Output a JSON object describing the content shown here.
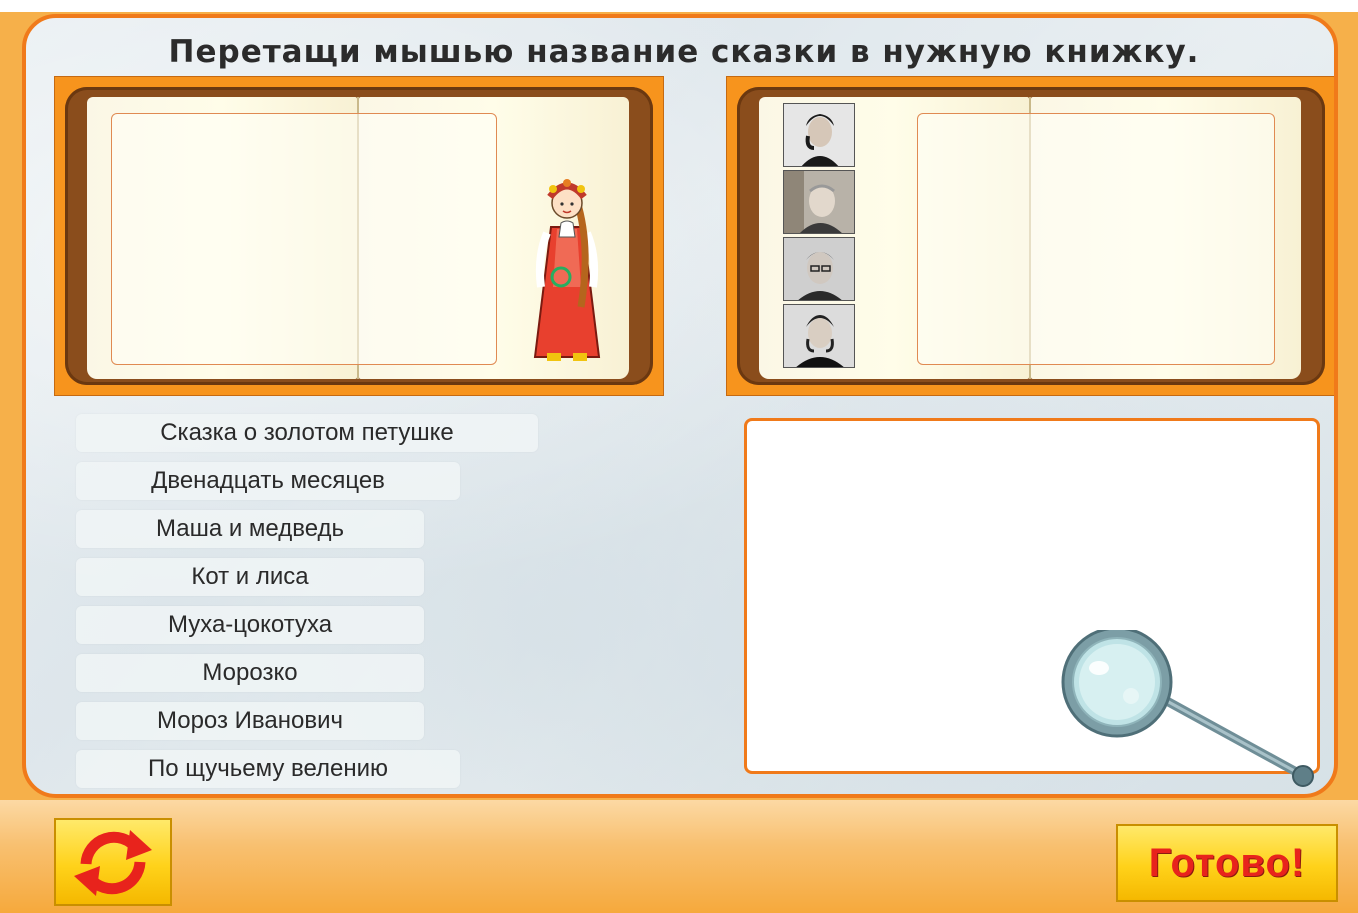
{
  "instruction": "Перетащи мышью название сказки в нужную книжку.",
  "tales": [
    "Сказка о золотом петушке",
    "Двенадцать месяцев",
    "Маша и медведь",
    "Кот и лиса",
    "Муха-цокотуха",
    "Морозко",
    "Мороз Иванович",
    "По щучьему велению"
  ],
  "done_button": "Готово!",
  "colors": {
    "frame": "#f07a1a",
    "book_cover": "#8a4d1c",
    "button": "#ffd21a",
    "done_text": "#e8231c"
  },
  "icons": {
    "refresh": "refresh-arrows-icon",
    "magnifier": "magnifier-icon"
  }
}
